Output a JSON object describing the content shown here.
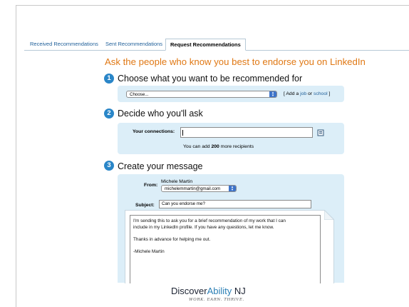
{
  "tabs": [
    {
      "label": "Received Recommendations"
    },
    {
      "label": "Sent Recommendations"
    },
    {
      "label": "Request Recommendations"
    }
  ],
  "headline": "Ask the people who know you best to endorse you on LinkedIn",
  "step1": {
    "number": "1",
    "title": "Choose what you want to be recommended for",
    "select_value": "Choose...",
    "add_open": "[ Add a ",
    "job_link": "job",
    "or_text": " or ",
    "school_link": "school",
    "add_close": " ]"
  },
  "step2": {
    "number": "2",
    "title": "Decide who you'll ask",
    "connections_label": "Your connections:",
    "hint_prefix": "You can add ",
    "hint_count": "200",
    "hint_suffix": " more recipients"
  },
  "step3": {
    "number": "3",
    "title": "Create your message",
    "from_label": "From:",
    "from_name": "Michele Martin",
    "from_email": "michelemmartin@gmail.com",
    "subject_label": "Subject:",
    "subject_value": "Can you endorse me?",
    "body_lines": [
      "I'm sending this to ask you for a brief recommendation of my work that I can",
      "include in my LinkedIn profile. If you have any questions, let me know."
    ],
    "body_thanks": "Thanks in advance for helping me out.",
    "body_sign": "-Michele Martin"
  },
  "footer": {
    "brand_prefix": "Discover",
    "brand_accent": "Ability",
    "brand_suffix": " NJ",
    "tagline": "WORK. EARN. THRIVE."
  },
  "colors": {
    "headline": "#e07814",
    "step_circle": "#2a86c8",
    "panel": "#dceef8",
    "link": "#1f5f99"
  },
  "icons": {
    "address_book": "address-book-icon",
    "select_arrow": "select-arrow-icon"
  }
}
